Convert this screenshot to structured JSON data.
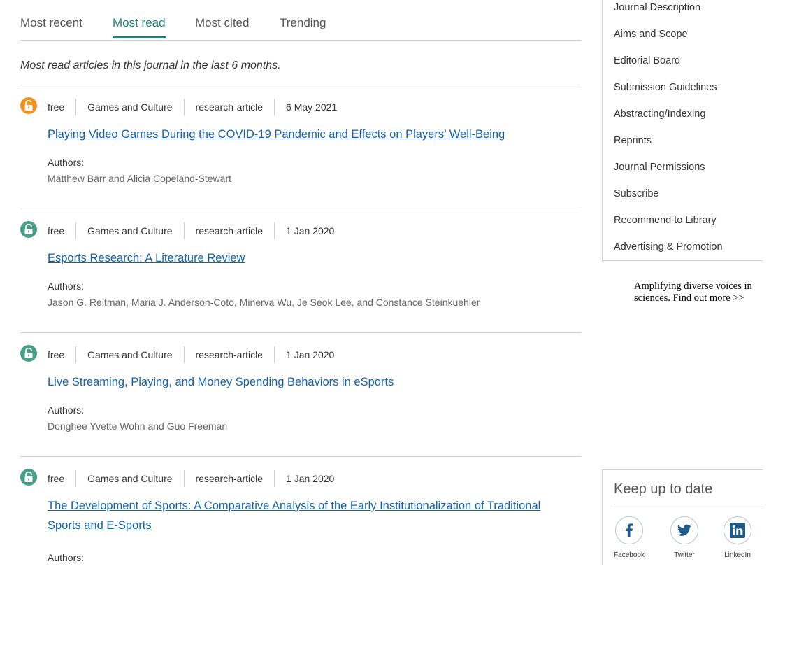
{
  "tabs": [
    "Most recent",
    "Most read",
    "Most cited",
    "Trending"
  ],
  "active_tab": "Most read",
  "description": "Most read articles in this journal in the last 6 months.",
  "authors_label": "Authors:",
  "articles": [
    {
      "access": "free",
      "access_icon": "lock-open-icon",
      "access_color": "#f2921e",
      "journal": "Games and Culture",
      "type": "research-article",
      "date": "6 May 2021",
      "title": "Playing Video Games During the COVID-19 Pandemic and Effects on Players’ Well-Being",
      "authors": "Matthew Barr and Alicia Copeland-Stewart"
    },
    {
      "access": "free",
      "access_icon": "lock-open-icon",
      "access_color": "#45a087",
      "journal": "Games and Culture",
      "type": "research-article",
      "date": "1 Jan 2020",
      "title": "Esports Research: A Literature Review",
      "authors": "Jason G. Reitman, Maria J. Anderson-Coto, Minerva Wu, Je Seok Lee, and Constance Steinkuehler"
    },
    {
      "access": "free",
      "access_icon": "lock-open-icon",
      "access_color": "#45a087",
      "journal": "Games and Culture",
      "type": "research-article",
      "date": "1 Jan 2020",
      "title": "Live Streaming, Playing, and Money Spending Behaviors in eSports",
      "authors": "Donghee Yvette Wohn and Guo Freeman"
    },
    {
      "access": "free",
      "access_icon": "lock-open-icon",
      "access_color": "#45a087",
      "journal": "Games and Culture",
      "type": "research-article",
      "date": "1 Jan 2020",
      "title": "The Development of Sports: A Comparative Analysis of the Early Institutionalization of Traditional Sports and E-Sports",
      "authors": ""
    }
  ],
  "journal_nav": [
    "Journal Description",
    "Aims and Scope",
    "Editorial Board",
    "Submission Guidelines",
    "Abstracting/Indexing",
    "Reprints",
    "Journal Permissions",
    "Subscribe",
    "Recommend to Library",
    "Advertising & Promotion"
  ],
  "promo": {
    "line1": "Amplifying diverse voices in",
    "line2": "sciences. Find out more >>"
  },
  "keep_up": {
    "title": "Keep up to date",
    "social": [
      {
        "label": "Facebook",
        "icon": "facebook-icon"
      },
      {
        "label": "Twitter",
        "icon": "twitter-icon"
      },
      {
        "label": "LinkedIn",
        "icon": "linkedin-icon"
      }
    ]
  },
  "colors": {
    "accent": "#1d7f7a",
    "link": "#1461b0",
    "social_icon": "#1e5b8a"
  }
}
